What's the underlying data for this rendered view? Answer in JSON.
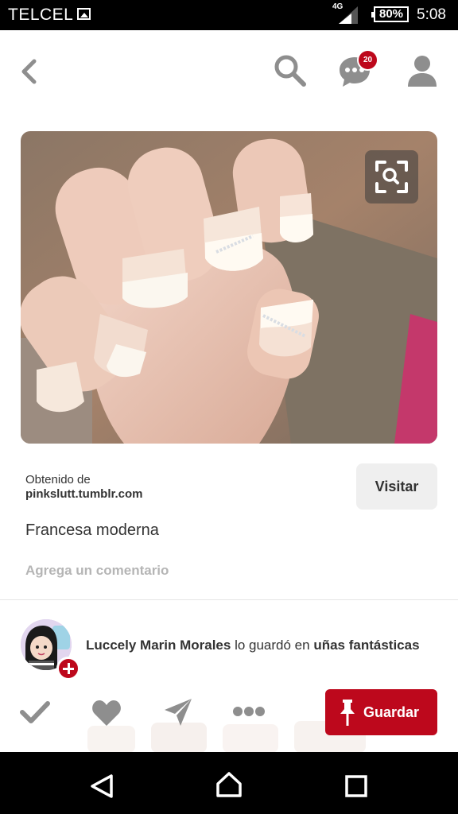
{
  "status_bar": {
    "carrier": "TELCEL",
    "network": "4G",
    "battery": "80%",
    "time": "5:08"
  },
  "header": {
    "notifications_count": "20",
    "icons": [
      "back-arrow-icon",
      "search-icon",
      "chat-bubble-icon",
      "profile-icon"
    ]
  },
  "pin": {
    "source_label": "Obtenido de",
    "source_domain": "pinkslutt.tumblr.com",
    "visit_label": "Visitar",
    "title": "Francesa moderna",
    "comment_placeholder": "Agrega un comentario"
  },
  "attribution": {
    "user": "Luccely Marin Morales",
    "action": " lo guardó en ",
    "board": "uñas fantásticas"
  },
  "actions": {
    "save_label": "Guardar",
    "icons": [
      "check-icon",
      "heart-icon",
      "send-icon",
      "more-icon"
    ]
  },
  "colors": {
    "brand_red": "#bd081c",
    "icon_gray": "#8e8e8e"
  }
}
